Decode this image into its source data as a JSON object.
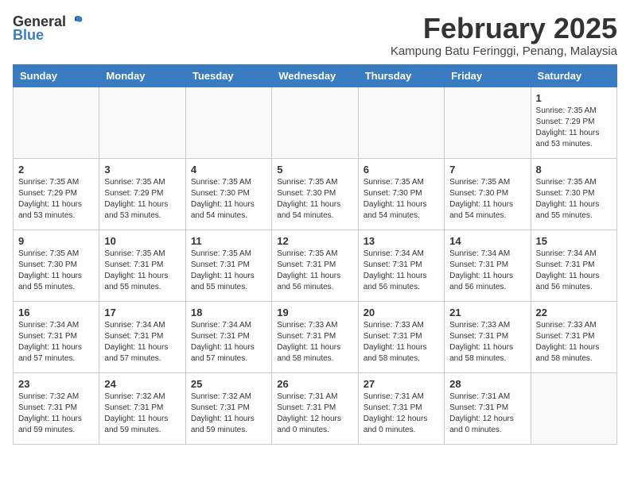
{
  "logo": {
    "general": "General",
    "blue": "Blue"
  },
  "header": {
    "month_year": "February 2025",
    "location": "Kampung Batu Feringgi, Penang, Malaysia"
  },
  "weekdays": [
    "Sunday",
    "Monday",
    "Tuesday",
    "Wednesday",
    "Thursday",
    "Friday",
    "Saturday"
  ],
  "weeks": [
    [
      {
        "day": "",
        "info": ""
      },
      {
        "day": "",
        "info": ""
      },
      {
        "day": "",
        "info": ""
      },
      {
        "day": "",
        "info": ""
      },
      {
        "day": "",
        "info": ""
      },
      {
        "day": "",
        "info": ""
      },
      {
        "day": "1",
        "info": "Sunrise: 7:35 AM\nSunset: 7:29 PM\nDaylight: 11 hours\nand 53 minutes."
      }
    ],
    [
      {
        "day": "2",
        "info": "Sunrise: 7:35 AM\nSunset: 7:29 PM\nDaylight: 11 hours\nand 53 minutes."
      },
      {
        "day": "3",
        "info": "Sunrise: 7:35 AM\nSunset: 7:29 PM\nDaylight: 11 hours\nand 53 minutes."
      },
      {
        "day": "4",
        "info": "Sunrise: 7:35 AM\nSunset: 7:30 PM\nDaylight: 11 hours\nand 54 minutes."
      },
      {
        "day": "5",
        "info": "Sunrise: 7:35 AM\nSunset: 7:30 PM\nDaylight: 11 hours\nand 54 minutes."
      },
      {
        "day": "6",
        "info": "Sunrise: 7:35 AM\nSunset: 7:30 PM\nDaylight: 11 hours\nand 54 minutes."
      },
      {
        "day": "7",
        "info": "Sunrise: 7:35 AM\nSunset: 7:30 PM\nDaylight: 11 hours\nand 54 minutes."
      },
      {
        "day": "8",
        "info": "Sunrise: 7:35 AM\nSunset: 7:30 PM\nDaylight: 11 hours\nand 55 minutes."
      }
    ],
    [
      {
        "day": "9",
        "info": "Sunrise: 7:35 AM\nSunset: 7:30 PM\nDaylight: 11 hours\nand 55 minutes."
      },
      {
        "day": "10",
        "info": "Sunrise: 7:35 AM\nSunset: 7:31 PM\nDaylight: 11 hours\nand 55 minutes."
      },
      {
        "day": "11",
        "info": "Sunrise: 7:35 AM\nSunset: 7:31 PM\nDaylight: 11 hours\nand 55 minutes."
      },
      {
        "day": "12",
        "info": "Sunrise: 7:35 AM\nSunset: 7:31 PM\nDaylight: 11 hours\nand 56 minutes."
      },
      {
        "day": "13",
        "info": "Sunrise: 7:34 AM\nSunset: 7:31 PM\nDaylight: 11 hours\nand 56 minutes."
      },
      {
        "day": "14",
        "info": "Sunrise: 7:34 AM\nSunset: 7:31 PM\nDaylight: 11 hours\nand 56 minutes."
      },
      {
        "day": "15",
        "info": "Sunrise: 7:34 AM\nSunset: 7:31 PM\nDaylight: 11 hours\nand 56 minutes."
      }
    ],
    [
      {
        "day": "16",
        "info": "Sunrise: 7:34 AM\nSunset: 7:31 PM\nDaylight: 11 hours\nand 57 minutes."
      },
      {
        "day": "17",
        "info": "Sunrise: 7:34 AM\nSunset: 7:31 PM\nDaylight: 11 hours\nand 57 minutes."
      },
      {
        "day": "18",
        "info": "Sunrise: 7:34 AM\nSunset: 7:31 PM\nDaylight: 11 hours\nand 57 minutes."
      },
      {
        "day": "19",
        "info": "Sunrise: 7:33 AM\nSunset: 7:31 PM\nDaylight: 11 hours\nand 58 minutes."
      },
      {
        "day": "20",
        "info": "Sunrise: 7:33 AM\nSunset: 7:31 PM\nDaylight: 11 hours\nand 58 minutes."
      },
      {
        "day": "21",
        "info": "Sunrise: 7:33 AM\nSunset: 7:31 PM\nDaylight: 11 hours\nand 58 minutes."
      },
      {
        "day": "22",
        "info": "Sunrise: 7:33 AM\nSunset: 7:31 PM\nDaylight: 11 hours\nand 58 minutes."
      }
    ],
    [
      {
        "day": "23",
        "info": "Sunrise: 7:32 AM\nSunset: 7:31 PM\nDaylight: 11 hours\nand 59 minutes."
      },
      {
        "day": "24",
        "info": "Sunrise: 7:32 AM\nSunset: 7:31 PM\nDaylight: 11 hours\nand 59 minutes."
      },
      {
        "day": "25",
        "info": "Sunrise: 7:32 AM\nSunset: 7:31 PM\nDaylight: 11 hours\nand 59 minutes."
      },
      {
        "day": "26",
        "info": "Sunrise: 7:31 AM\nSunset: 7:31 PM\nDaylight: 12 hours\nand 0 minutes."
      },
      {
        "day": "27",
        "info": "Sunrise: 7:31 AM\nSunset: 7:31 PM\nDaylight: 12 hours\nand 0 minutes."
      },
      {
        "day": "28",
        "info": "Sunrise: 7:31 AM\nSunset: 7:31 PM\nDaylight: 12 hours\nand 0 minutes."
      },
      {
        "day": "",
        "info": ""
      }
    ]
  ]
}
